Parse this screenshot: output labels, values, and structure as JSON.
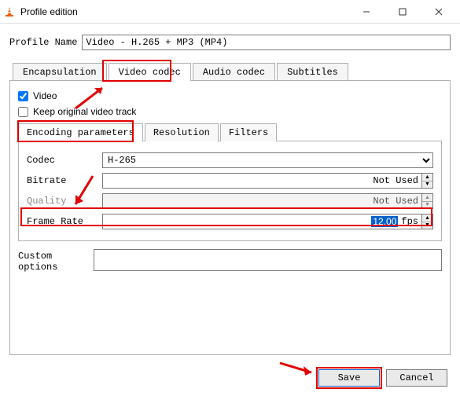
{
  "window": {
    "title": "Profile edition"
  },
  "profile": {
    "name_label": "Profile Name",
    "name_value": "Video - H.265 + MP3 (MP4)"
  },
  "tabs": {
    "encapsulation": "Encapsulation",
    "video_codec": "Video codec",
    "audio_codec": "Audio codec",
    "subtitles": "Subtitles"
  },
  "video_checkbox": "Video",
  "keep_original": "Keep original video track",
  "subtabs": {
    "encoding": "Encoding parameters",
    "resolution": "Resolution",
    "filters": "Filters"
  },
  "fields": {
    "codec_label": "Codec",
    "codec_value": "H-265",
    "bitrate_label": "Bitrate",
    "bitrate_value": "Not Used",
    "quality_label": "Quality",
    "quality_value": "Not Used",
    "framerate_label": "Frame Rate",
    "framerate_value": "12.00",
    "framerate_unit": "fps",
    "custom_label": "Custom options"
  },
  "buttons": {
    "save": "Save",
    "cancel": "Cancel"
  }
}
